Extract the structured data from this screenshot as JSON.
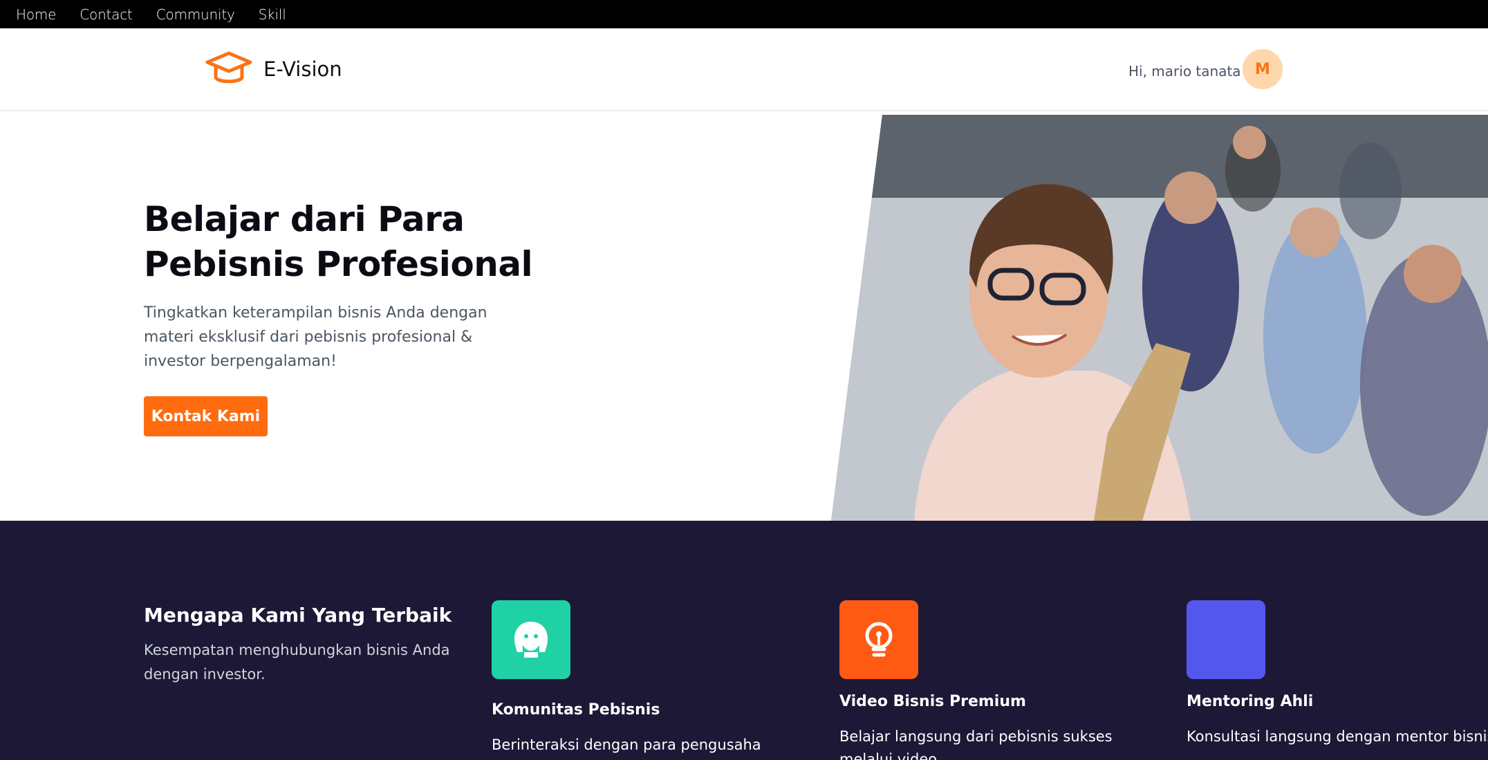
{
  "topnav": {
    "items": [
      {
        "label": "Home"
      },
      {
        "label": "Contact"
      },
      {
        "label": "Community"
      },
      {
        "label": "Skill"
      }
    ]
  },
  "header": {
    "brand_name": "E-Vision",
    "logo_icon": "graduation-cap-icon",
    "greeting": "Hi, mario tanata",
    "avatar_initial": "M"
  },
  "hero": {
    "title_line1": "Belajar dari Para",
    "title_line2": "Pebisnis Profesional",
    "subtitle": "Tingkatkan keterampilan bisnis Anda dengan materi eksklusif dari pebisnis profesional & investor berpengalaman!",
    "cta_label": "Kontak Kami"
  },
  "features": {
    "title": "Mengapa Kami Yang Terbaik",
    "subtitle": "Kesempatan menghubungkan bisnis Anda dengan investor.",
    "items": [
      {
        "title": "Komunitas Pebisnis",
        "desc": "Berinteraksi dengan para pengusaha",
        "icon": "community-icon",
        "color": "#1fd1a5"
      },
      {
        "title": "Video Bisnis Premium",
        "desc": "Belajar langsung dari pebisnis sukses melalui video",
        "icon": "lightbulb-icon",
        "color": "#ff5a14"
      },
      {
        "title": "Mentoring Ahli",
        "desc": "Konsultasi langsung dengan mentor bisnis",
        "icon": "mentor-icon",
        "color": "#5457ec"
      }
    ]
  },
  "colors": {
    "accent": "#ff6b0f",
    "features_bg": "#1c1836",
    "topbar_bg": "#000000",
    "avatar_bg": "#fed7aa"
  }
}
